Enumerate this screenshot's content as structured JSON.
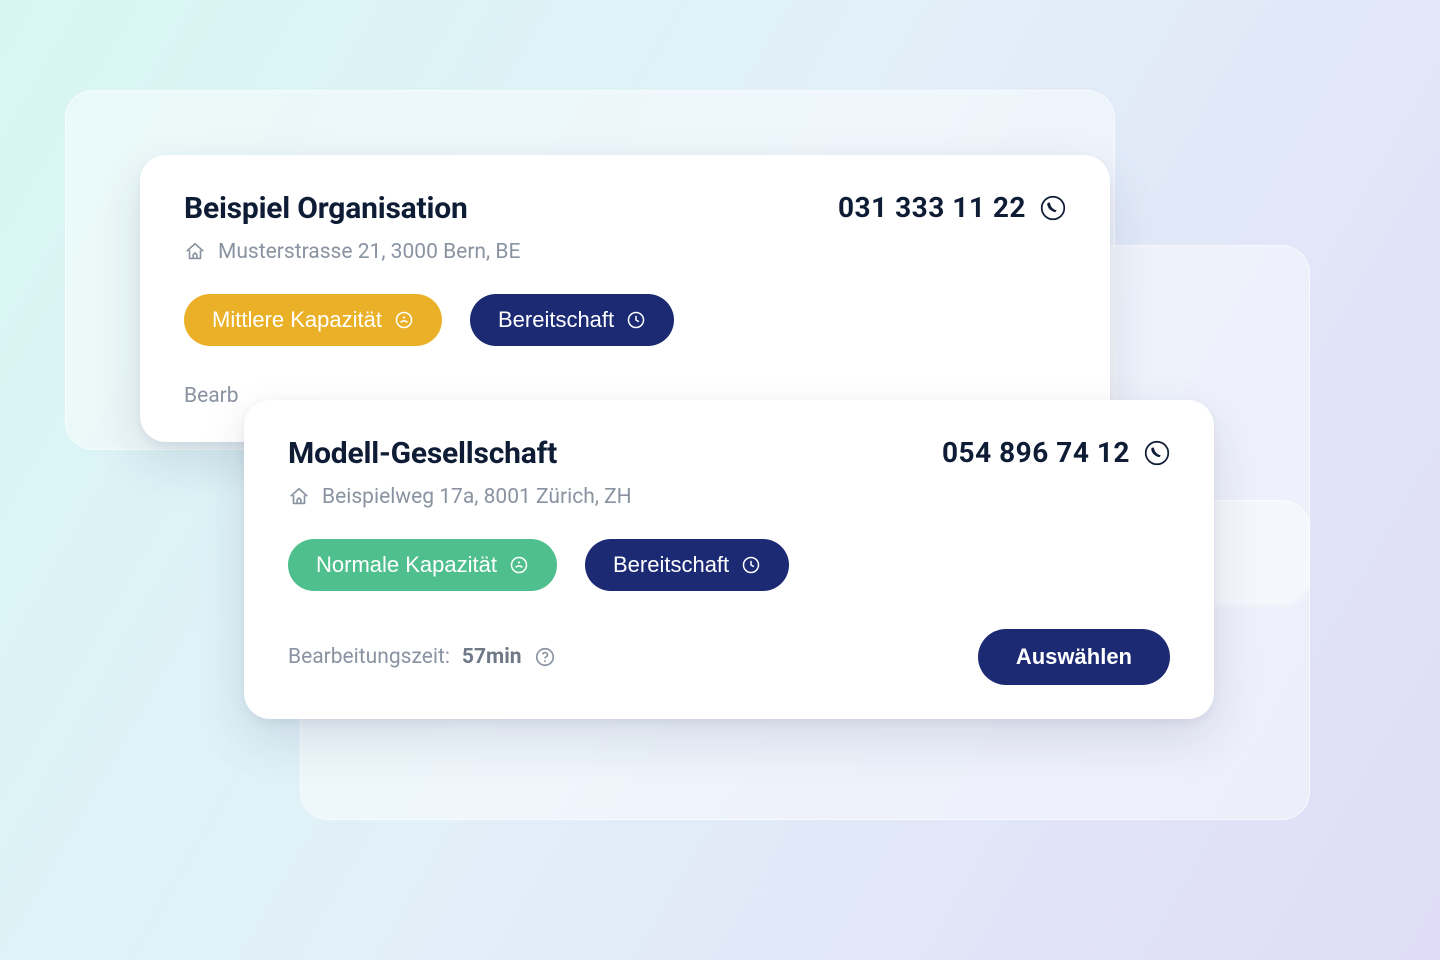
{
  "colors": {
    "capacity_medium": "#eab128",
    "capacity_normal": "#4fc08d",
    "standby": "#1b2a73",
    "select_button": "#1b2a73"
  },
  "labels": {
    "processing_time_prefix": "Bearbeitungszeit:",
    "select_button": "Auswählen"
  },
  "cards": [
    {
      "name": "Beispiel Organisation",
      "phone": "031 333 11 22",
      "address": "Musterstrasse 21, 3000 Bern, BE",
      "capacity": {
        "label": "Mittlere Kapazität",
        "color_key": "capacity_medium"
      },
      "standby": {
        "label": "Bereitschaft"
      },
      "proc_partial": "Bearb"
    },
    {
      "name": "Modell-Gesellschaft",
      "phone": "054 896 74 12",
      "address": "Beispielweg 17a, 8001 Zürich, ZH",
      "capacity": {
        "label": "Normale Kapazität",
        "color_key": "capacity_normal"
      },
      "standby": {
        "label": "Bereitschaft"
      },
      "processing_time": "57min"
    }
  ]
}
